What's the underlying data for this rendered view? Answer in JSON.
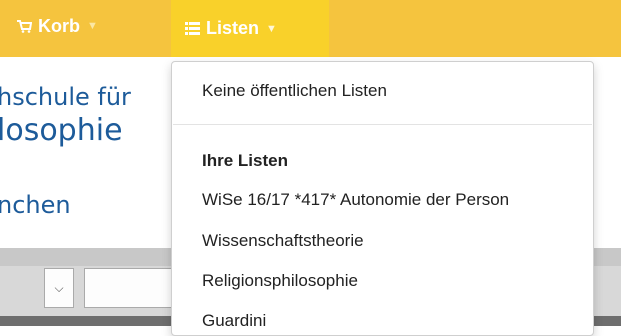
{
  "nav": {
    "korb_label": "Korb",
    "listen_label": "Listen",
    "korb_icon": "cart-icon",
    "listen_icon": "list-icon"
  },
  "header": {
    "line1": "hschule für",
    "line2": "losophie",
    "line3": "nchen"
  },
  "dropdown": {
    "public_empty": "Keine öffentlichen Listen",
    "section_title": "Ihre Listen",
    "items": [
      "WiSe 16/17 *417* Autonomie der Person",
      "Wissenschaftstheorie",
      "Religionsphilosophie",
      "Guardini"
    ]
  },
  "colors": {
    "topbar": "#f5c43e",
    "active_tab": "#f9d12a",
    "header_text": "#1d5b9a"
  }
}
